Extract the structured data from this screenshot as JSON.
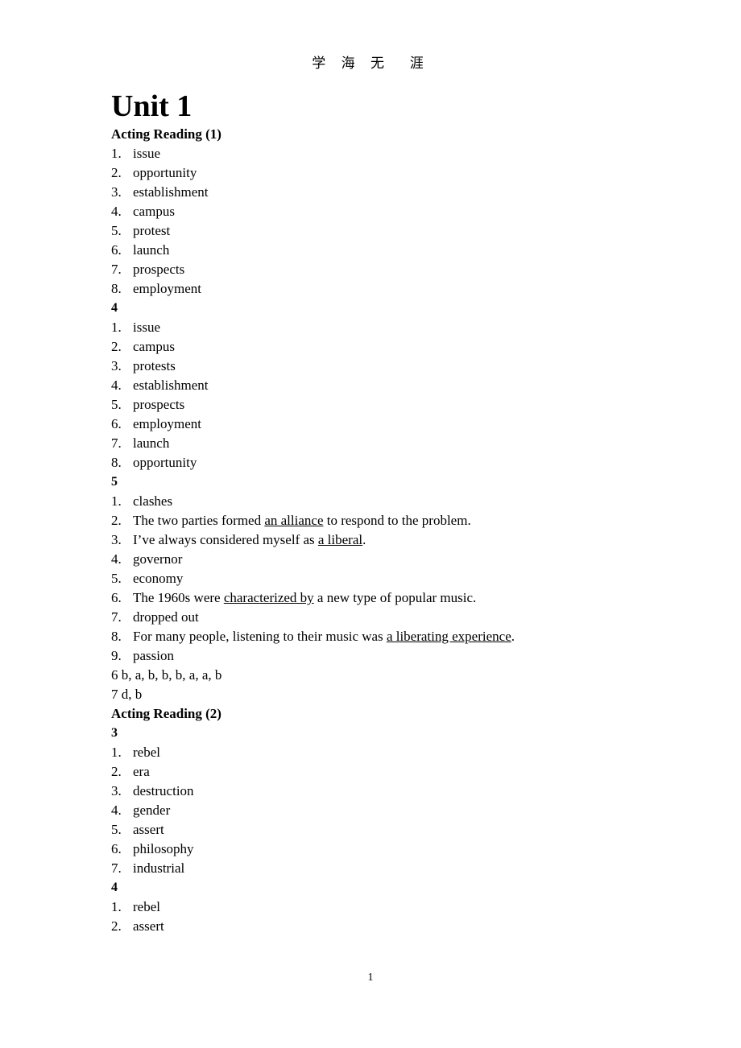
{
  "page": {
    "running_header": "学 海 无  涯",
    "page_number": "1",
    "title": "Unit 1"
  },
  "sections": [
    {
      "heading": "Acting Reading (1)",
      "groups": [
        {
          "label": null,
          "items": [
            {
              "marker": "1.",
              "text": "issue"
            },
            {
              "marker": "2.",
              "text": "opportunity"
            },
            {
              "marker": "3.",
              "text": "establishment"
            },
            {
              "marker": "4.",
              "text": "campus"
            },
            {
              "marker": "5.",
              "text": "protest"
            },
            {
              "marker": "6.",
              "text": "launch"
            },
            {
              "marker": "7.",
              "text": "prospects"
            },
            {
              "marker": "8.",
              "text": "employment"
            }
          ]
        },
        {
          "label": "4",
          "items": [
            {
              "marker": "1.",
              "text": "issue"
            },
            {
              "marker": "2.",
              "text": "campus"
            },
            {
              "marker": "3.",
              "text": "protests"
            },
            {
              "marker": "4.",
              "text": "establishment"
            },
            {
              "marker": "5.",
              "text": "prospects"
            },
            {
              "marker": "6.",
              "text": "employment"
            },
            {
              "marker": "7.",
              "text": "launch"
            },
            {
              "marker": "8.",
              "text": "opportunity"
            }
          ]
        },
        {
          "label": "5",
          "items": [
            {
              "marker": "1.",
              "text": "clashes"
            },
            {
              "marker": "2.",
              "pre": "The two parties formed ",
              "underline": "an alliance",
              "post": " to respond to the problem."
            },
            {
              "marker": "3.",
              "pre": "I’ve always considered myself as ",
              "underline": "a liberal",
              "post": "."
            },
            {
              "marker": "4.",
              "text": "governor"
            },
            {
              "marker": "5.",
              "text": "economy"
            },
            {
              "marker": "6.",
              "pre": "The 1960s were ",
              "underline": "characterized by",
              "post": " a new type of popular music."
            },
            {
              "marker": "7.",
              "text": "dropped out"
            },
            {
              "marker": "8.",
              "pre": "For many people, listening to their music was ",
              "underline": "a liberating experience",
              "post": "."
            },
            {
              "marker": "9.",
              "text": "passion"
            }
          ]
        }
      ],
      "trailing_lines": [
        "6 b, a, b, b, b, a, a, b",
        "7 d, b"
      ]
    },
    {
      "heading": "Acting Reading (2)",
      "groups": [
        {
          "label": "3",
          "items": [
            {
              "marker": "1.",
              "text": "rebel"
            },
            {
              "marker": "2.",
              "text": "era"
            },
            {
              "marker": "3.",
              "text": "destruction"
            },
            {
              "marker": "4.",
              "text": "gender"
            },
            {
              "marker": "5.",
              "text": "assert"
            },
            {
              "marker": "6.",
              "text": "philosophy"
            },
            {
              "marker": "7.",
              "text": "industrial"
            }
          ]
        },
        {
          "label": "4",
          "items": [
            {
              "marker": "1.",
              "text": "rebel"
            },
            {
              "marker": "2.",
              "text": "assert"
            }
          ]
        }
      ],
      "trailing_lines": []
    }
  ]
}
